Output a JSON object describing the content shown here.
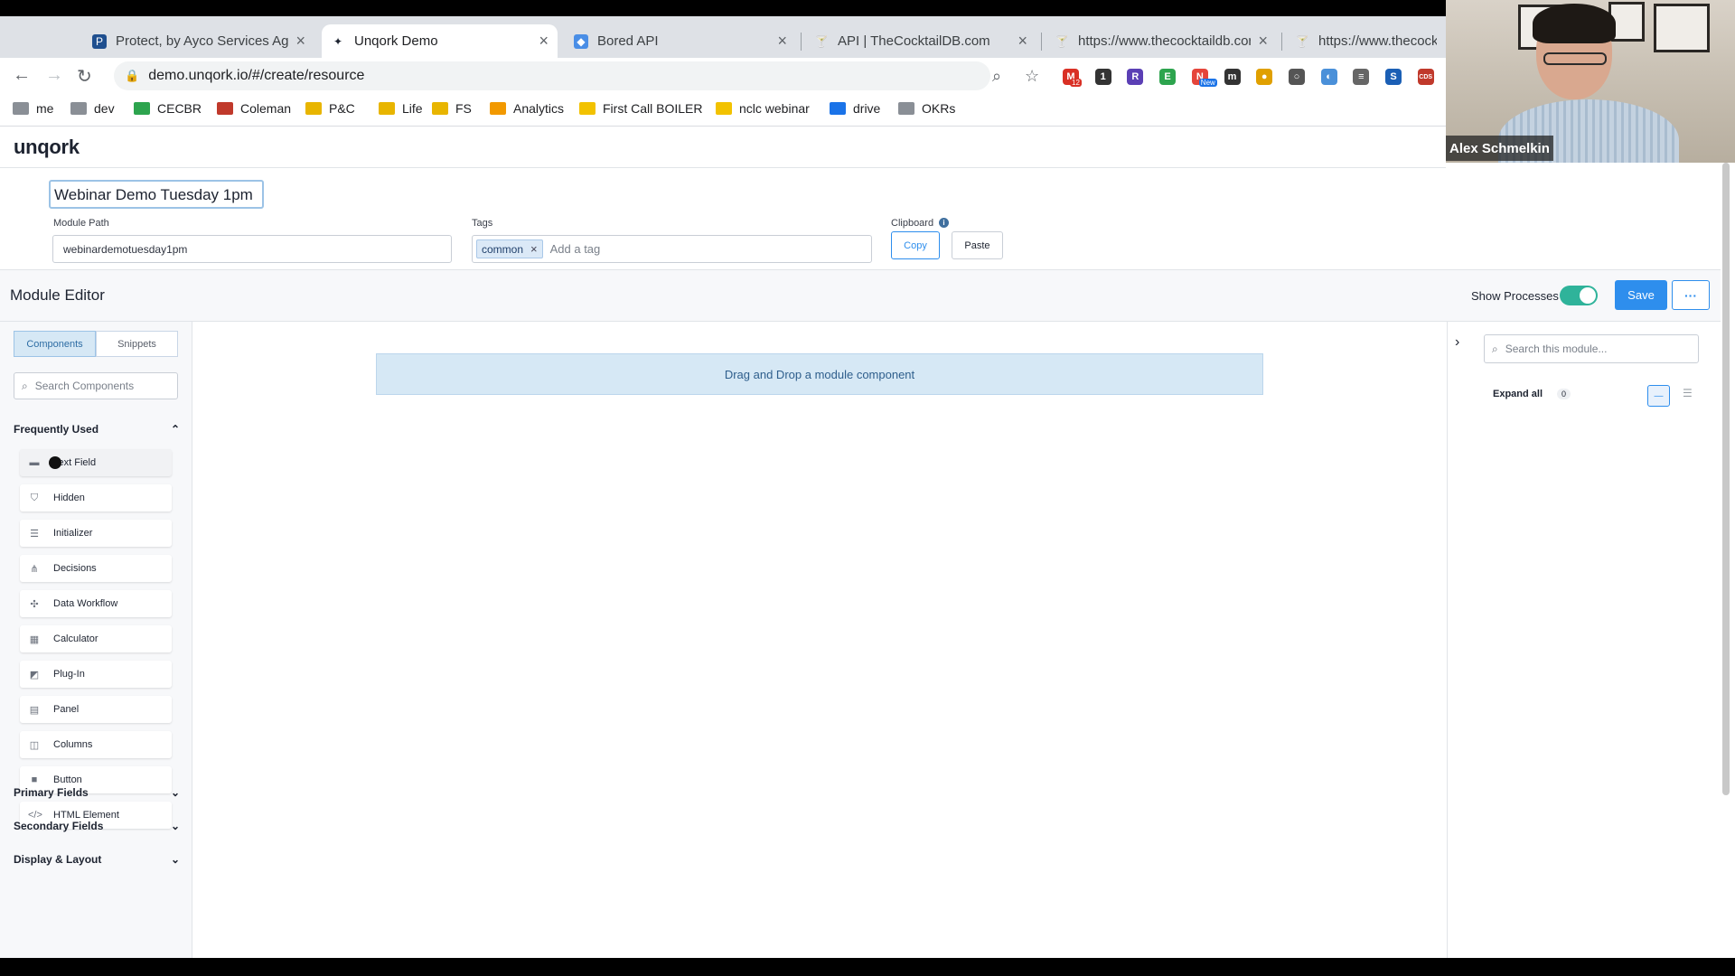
{
  "browser": {
    "tabs": [
      {
        "title": "Protect, by Ayco Services Age",
        "favicon": "P",
        "color": "#1f4f8f"
      },
      {
        "title": "Unqork Demo",
        "favicon": "✦",
        "color": "#1d2330"
      },
      {
        "title": "Bored API",
        "favicon": "◆",
        "color": "#4a8ee6"
      },
      {
        "title": "API | TheCocktailDB.com",
        "favicon": "🍸",
        "color": "#c0392b"
      },
      {
        "title": "https://www.thecocktaildb.cor",
        "favicon": "🍸",
        "color": "#555"
      },
      {
        "title": "https://www.thecockta",
        "favicon": "🍸",
        "color": "#555"
      }
    ],
    "url": "demo.unqork.io/#/create/resource",
    "extensions": [
      {
        "label": "M",
        "badge": "12",
        "color": "#d93025"
      },
      {
        "label": "1",
        "color": "#333"
      },
      {
        "label": "R",
        "color": "#5b3fb5"
      },
      {
        "label": "E",
        "color": "#2da44e"
      },
      {
        "label": "N",
        "badge": "New",
        "color": "#e5453b"
      },
      {
        "label": "m",
        "color": "#333"
      },
      {
        "label": "●",
        "color": "#e0a000"
      },
      {
        "label": "○",
        "color": "#555"
      },
      {
        "label": "◐",
        "color": "#4a90d9"
      },
      {
        "label": "≡",
        "color": "#666"
      },
      {
        "label": "S",
        "color": "#1b5fb5"
      },
      {
        "label": "CDS",
        "color": "#c0392b"
      }
    ],
    "bookmarks": [
      {
        "label": "me",
        "color": "#8a8f96"
      },
      {
        "label": "dev",
        "color": "#8a8f96"
      },
      {
        "label": "CECBR",
        "color": "#2da44e"
      },
      {
        "label": "Coleman",
        "color": "#c0392b"
      },
      {
        "label": "P&C",
        "color": "#e8b500"
      },
      {
        "label": "Life",
        "color": "#e8b500"
      },
      {
        "label": "FS",
        "color": "#e8b500"
      },
      {
        "label": "Analytics",
        "color": "#f29900"
      },
      {
        "label": "First Call BOILER",
        "color": "#f2c200"
      },
      {
        "label": "nclc webinar",
        "color": "#f2c200"
      },
      {
        "label": "drive",
        "color": "#1a73e8"
      },
      {
        "label": "OKRs",
        "color": "#8a8f96"
      }
    ]
  },
  "app": {
    "logo": "unqork",
    "module_title": "Webinar Demo Tuesday 1pm",
    "module_path_label": "Module Path",
    "module_path": "webinardemotuesday1pm",
    "tags_label": "Tags",
    "tag": "common",
    "tag_placeholder": "Add a tag",
    "clipboard_label": "Clipboard",
    "copy_label": "Copy",
    "paste_label": "Paste",
    "editor_title": "Module Editor",
    "show_processes_label": "Show Processes",
    "show_processes_on": true,
    "save_label": "Save",
    "more_label": "···"
  },
  "sidebar": {
    "tabs": [
      "Components",
      "Snippets"
    ],
    "active_tab": "Components",
    "search_placeholder": "Search Components",
    "frequently_used_label": "Frequently Used",
    "items": [
      {
        "label": "Text Field",
        "icon": "text-field-icon",
        "glyph": "▬"
      },
      {
        "label": "Hidden",
        "icon": "hidden-icon",
        "glyph": "⛉"
      },
      {
        "label": "Initializer",
        "icon": "initializer-icon",
        "glyph": "☰"
      },
      {
        "label": "Decisions",
        "icon": "decisions-icon",
        "glyph": "⋔"
      },
      {
        "label": "Data Workflow",
        "icon": "data-workflow-icon",
        "glyph": "✣"
      },
      {
        "label": "Calculator",
        "icon": "calculator-icon",
        "glyph": "▦"
      },
      {
        "label": "Plug-In",
        "icon": "plug-in-icon",
        "glyph": "◩"
      },
      {
        "label": "Panel",
        "icon": "panel-icon",
        "glyph": "▤"
      },
      {
        "label": "Columns",
        "icon": "columns-icon",
        "glyph": "◫"
      },
      {
        "label": "Button",
        "icon": "button-icon",
        "glyph": "■"
      },
      {
        "label": "HTML Element",
        "icon": "html-icon",
        "glyph": "</>"
      }
    ],
    "sections": [
      "Primary Fields",
      "Secondary Fields",
      "Display & Layout"
    ]
  },
  "canvas": {
    "dropzone_text": "Drag and Drop a module component"
  },
  "right_panel": {
    "search_placeholder": "Search this module...",
    "expand_all_label": "Expand all",
    "count": "0"
  },
  "webcam": {
    "name": "Alex Schmelkin"
  }
}
